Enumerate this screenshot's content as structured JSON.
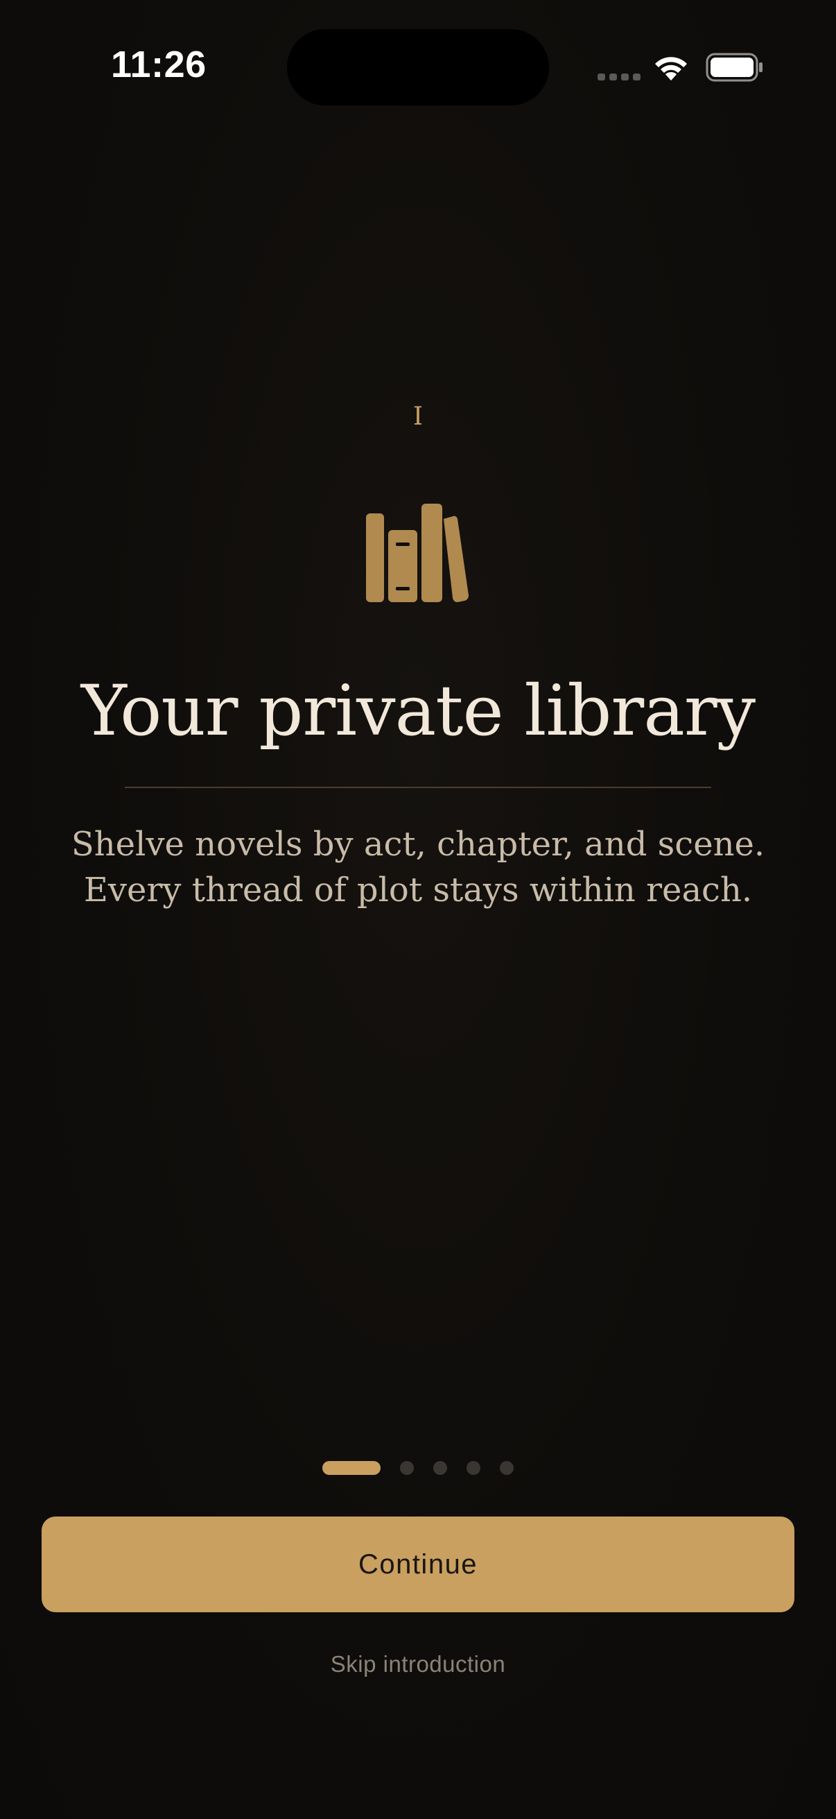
{
  "status_bar": {
    "time": "11:26",
    "icons": [
      "cellular-signal-icon",
      "wifi-icon",
      "battery-icon"
    ]
  },
  "onboarding": {
    "step_numeral": "I",
    "icon": "books-icon",
    "title": "Your private library",
    "description_lines": [
      "Shelve novels by act, chapter, and scene.",
      "Every thread of plot stays within reach."
    ],
    "pagination": {
      "total": 5,
      "current": 1
    }
  },
  "actions": {
    "continue_label": "Continue",
    "skip_label": "Skip introduction"
  },
  "colors": {
    "background": "#0f0d0b",
    "accent": "#c9a05f",
    "title_text": "#f2e8da",
    "body_text": "#c8bba8",
    "muted_text": "#8c8276",
    "inactive_dot": "#3a3632"
  }
}
